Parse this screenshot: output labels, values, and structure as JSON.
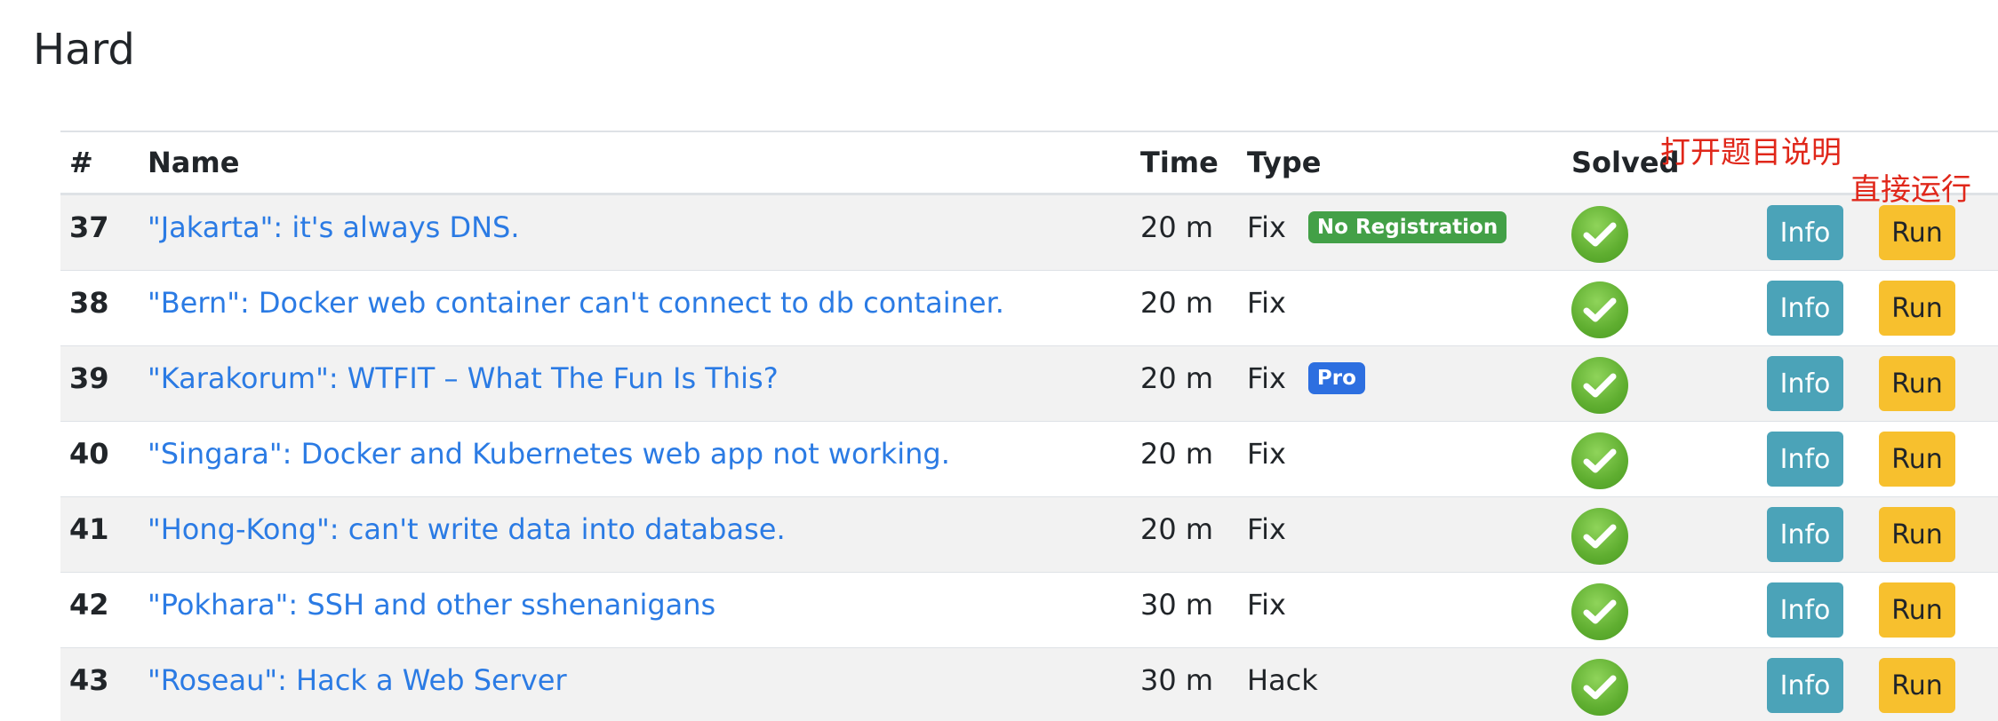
{
  "section_title": "Hard",
  "columns": {
    "num": "#",
    "name": "Name",
    "time": "Time",
    "type": "Type",
    "solved": "Solved"
  },
  "annotations": {
    "info_note": "打开题目说明",
    "run_note": "直接运行"
  },
  "buttons": {
    "info_label": "Info",
    "run_label": "Run"
  },
  "rows": [
    {
      "num": "37",
      "name": "\"Jakarta\": it's always DNS.",
      "time": "20 m",
      "type": "Fix",
      "badge": "No Registration",
      "badge_color": "#43a047",
      "solved": true
    },
    {
      "num": "38",
      "name": "\"Bern\": Docker web container can't connect to db container.",
      "time": "20 m",
      "type": "Fix",
      "badge": "",
      "solved": true
    },
    {
      "num": "39",
      "name": "\"Karakorum\": WTFIT – What The Fun Is This?",
      "time": "20 m",
      "type": "Fix",
      "badge": "Pro",
      "badge_color": "#2d6fe0",
      "solved": true
    },
    {
      "num": "40",
      "name": "\"Singara\": Docker and Kubernetes web app not working.",
      "time": "20 m",
      "type": "Fix",
      "badge": "",
      "solved": true
    },
    {
      "num": "41",
      "name": "\"Hong-Kong\": can't write data into database.",
      "time": "20 m",
      "type": "Fix",
      "badge": "",
      "solved": true
    },
    {
      "num": "42",
      "name": "\"Pokhara\": SSH and other sshenanigans",
      "time": "30 m",
      "type": "Fix",
      "badge": "",
      "solved": true
    },
    {
      "num": "43",
      "name": "\"Roseau\": Hack a Web Server",
      "time": "30 m",
      "type": "Hack",
      "badge": "",
      "solved": true
    }
  ],
  "colors": {
    "link": "#2b7be4",
    "info_button": "#4ba3b8",
    "run_button": "#f7c02e",
    "annotation": "#e0271a",
    "solved_check": "#5fae30"
  }
}
